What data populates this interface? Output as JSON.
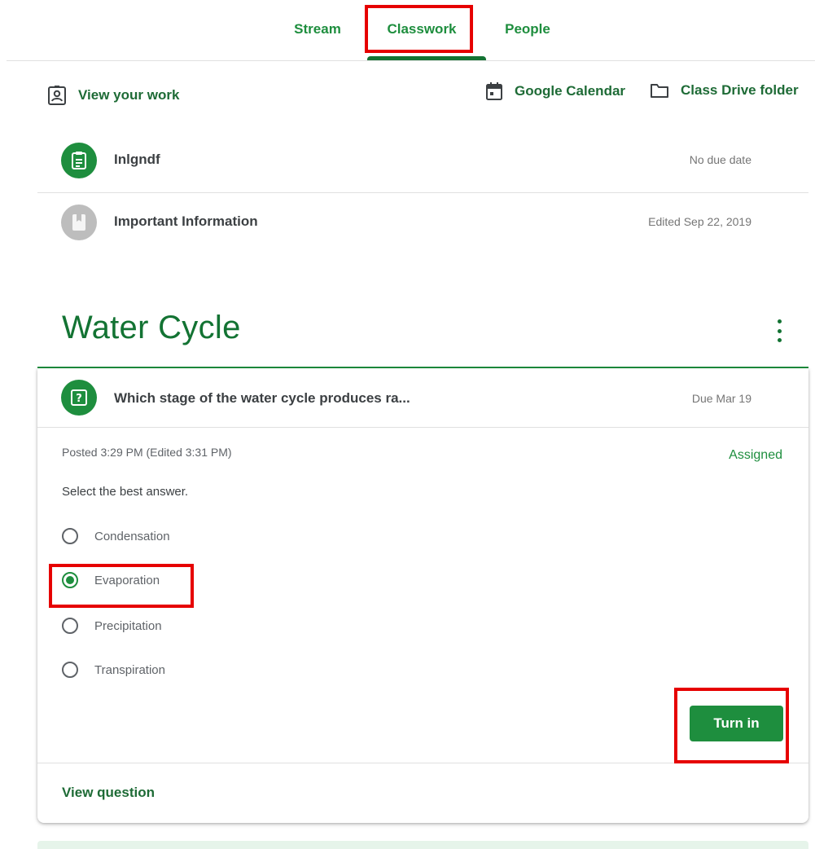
{
  "tabs": {
    "stream": "Stream",
    "classwork": "Classwork",
    "people": "People"
  },
  "toolbar": {
    "view_your_work": "View your work",
    "google_calendar": "Google Calendar",
    "class_drive_folder": "Class Drive folder"
  },
  "materials": [
    {
      "title": "Inlgndf",
      "meta": "No due date",
      "icon": "assignment-icon"
    },
    {
      "title": "Important Information",
      "meta": "Edited Sep 22, 2019",
      "icon": "material-icon"
    }
  ],
  "topic": {
    "title": "Water Cycle"
  },
  "question": {
    "title": "Which stage of the water cycle produces ra...",
    "due": "Due Mar 19",
    "posted": "Posted 3:29 PM (Edited 3:31 PM)",
    "status": "Assigned",
    "instruction": "Select the best answer.",
    "options": [
      "Condensation",
      "Evaporation",
      "Precipitation",
      "Transpiration"
    ],
    "selected": "Evaporation",
    "turn_in_label": "Turn in",
    "view_question_label": "View question",
    "icon": "question-icon"
  },
  "colors": {
    "brand_green": "#1e8e3e",
    "dark_green": "#137333",
    "highlight_red": "#e60000",
    "muted_gray": "#bdbdbd"
  }
}
